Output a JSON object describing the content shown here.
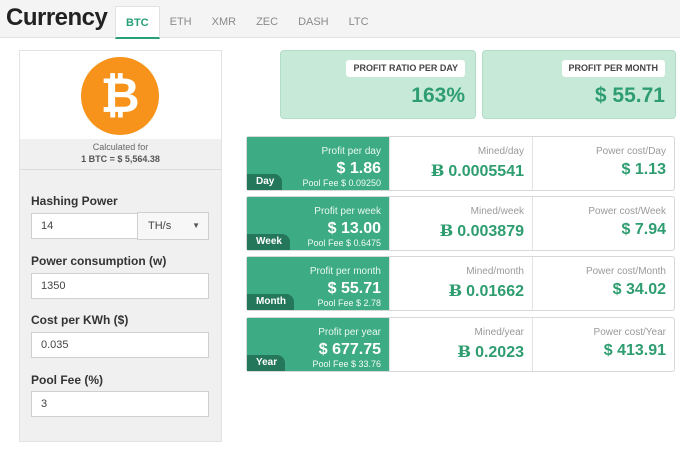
{
  "header": {
    "title": "Currency",
    "tabs": [
      {
        "label": "BTC",
        "active": true
      },
      {
        "label": "ETH",
        "active": false
      },
      {
        "label": "XMR",
        "active": false
      },
      {
        "label": "ZEC",
        "active": false
      },
      {
        "label": "DASH",
        "active": false
      },
      {
        "label": "LTC",
        "active": false
      }
    ]
  },
  "sidebar": {
    "coin_icon": "bitcoin-logo",
    "coin_symbol": "₿",
    "calculated_for": "Calculated for",
    "rate": "1 BTC = $ 5,564.38",
    "hashing_power": {
      "label": "Hashing Power",
      "value": "14",
      "unit": "TH/s"
    },
    "power_consumption": {
      "label": "Power consumption (w)",
      "value": "1350"
    },
    "cost_per_kwh": {
      "label": "Cost per KWh ($)",
      "value": "0.035"
    },
    "pool_fee": {
      "label": "Pool Fee (%)",
      "value": "3"
    }
  },
  "summary": {
    "profit_ratio": {
      "label": "PROFIT RATIO PER DAY",
      "value": "163%"
    },
    "profit_month": {
      "label": "PROFIT PER MONTH",
      "value": "$ 55.71"
    }
  },
  "btc_symbol": "Ƀ",
  "periods": [
    {
      "tag": "Day",
      "profit_label": "Profit per day",
      "profit": "$ 1.86",
      "pool_fee": "Pool Fee $ 0.09250",
      "mined_label": "Mined/day",
      "mined": "0.0005541",
      "power_label": "Power cost/Day",
      "power": "$ 1.13"
    },
    {
      "tag": "Week",
      "profit_label": "Profit per week",
      "profit": "$ 13.00",
      "pool_fee": "Pool Fee $ 0.6475",
      "mined_label": "Mined/week",
      "mined": "0.003879",
      "power_label": "Power cost/Week",
      "power": "$ 7.94"
    },
    {
      "tag": "Month",
      "profit_label": "Profit per month",
      "profit": "$ 55.71",
      "pool_fee": "Pool Fee $ 2.78",
      "mined_label": "Mined/month",
      "mined": "0.01662",
      "power_label": "Power cost/Month",
      "power": "$ 34.02"
    },
    {
      "tag": "Year",
      "profit_label": "Profit per year",
      "profit": "$ 677.75",
      "pool_fee": "Pool Fee $ 33.76",
      "mined_label": "Mined/year",
      "mined": "0.2023",
      "power_label": "Power cost/Year",
      "power": "$ 413.91"
    }
  ],
  "colors": {
    "accent": "#3dab84",
    "accent_dark": "#24775a",
    "value_green": "#2e9d70",
    "summary_bg": "#c7ead8",
    "bitcoin_orange": "#f7931a"
  }
}
